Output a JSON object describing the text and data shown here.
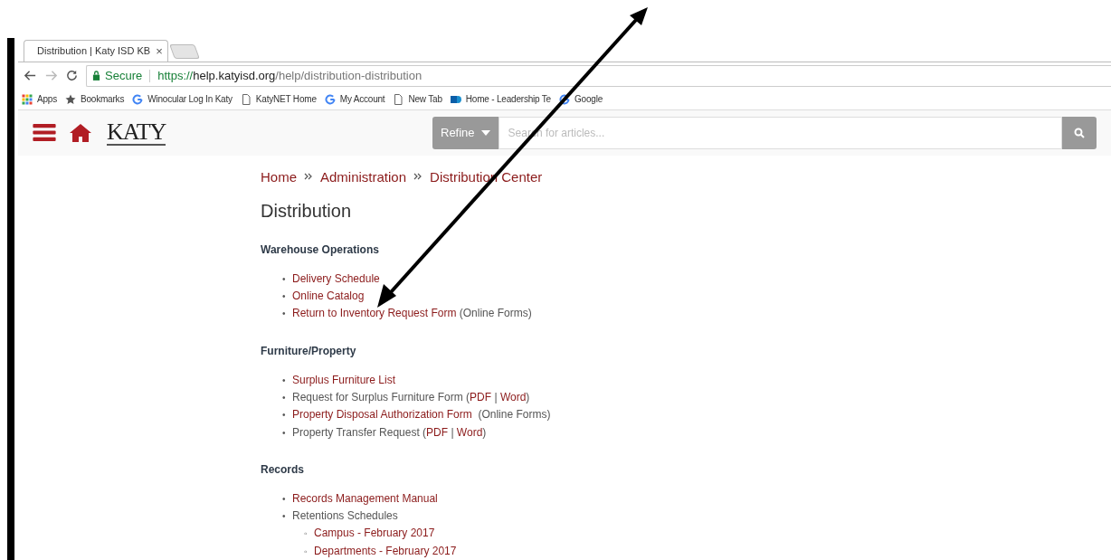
{
  "browser": {
    "tab": {
      "title": "Distribution | Katy ISD KB",
      "close": "×"
    },
    "address": {
      "secure_label": "Secure",
      "scheme": "https://",
      "host": "help.katyisd.org",
      "path": "/help/distribution-distribution"
    },
    "bookmarks": [
      {
        "kind": "apps",
        "label": "Apps"
      },
      {
        "kind": "star",
        "label": "Bookmarks"
      },
      {
        "kind": "google",
        "label": "Winocular Log In Katy"
      },
      {
        "kind": "page",
        "label": "KatyNET Home"
      },
      {
        "kind": "google",
        "label": "My Account"
      },
      {
        "kind": "page",
        "label": "New Tab"
      },
      {
        "kind": "sharepoint",
        "label": "Home - Leadership Te"
      },
      {
        "kind": "google",
        "label": "Google"
      }
    ]
  },
  "header": {
    "logo": "KATY",
    "refine": "Refine",
    "search": {
      "placeholder": "Search for articles..."
    }
  },
  "breadcrumbs": [
    "Home",
    "Administration",
    "Distribution Center"
  ],
  "title": "Distribution",
  "sections": [
    {
      "heading": "Warehouse Operations",
      "items": [
        {
          "marker": "•",
          "parts": [
            {
              "kind": "link",
              "text": "Delivery Schedule"
            }
          ]
        },
        {
          "marker": "•",
          "parts": [
            {
              "kind": "link",
              "text": "Online Catalog"
            }
          ]
        },
        {
          "marker": "•",
          "parts": [
            {
              "kind": "link",
              "text": "Return to Inventory Request Form"
            },
            {
              "kind": "text",
              "text": " (Online Forms)"
            }
          ]
        }
      ]
    },
    {
      "heading": "Furniture/Property",
      "items": [
        {
          "marker": "•",
          "parts": [
            {
              "kind": "link",
              "text": "Surplus Furniture List"
            }
          ]
        },
        {
          "marker": "•",
          "parts": [
            {
              "kind": "text",
              "text": "Request for Surplus Furniture Form ("
            },
            {
              "kind": "link",
              "text": "PDF"
            },
            {
              "kind": "text",
              "text": " | "
            },
            {
              "kind": "link",
              "text": "Word"
            },
            {
              "kind": "text",
              "text": ")"
            }
          ]
        },
        {
          "marker": "•",
          "parts": [
            {
              "kind": "link",
              "text": "Property Disposal Authorization Form"
            },
            {
              "kind": "text",
              "text": "  (Online Forms)"
            }
          ]
        },
        {
          "marker": "•",
          "parts": [
            {
              "kind": "text",
              "text": "Property Transfer Request ("
            },
            {
              "kind": "link",
              "text": "PDF"
            },
            {
              "kind": "text",
              "text": " | "
            },
            {
              "kind": "link",
              "text": "Word"
            },
            {
              "kind": "text",
              "text": ")"
            }
          ]
        }
      ]
    },
    {
      "heading": "Records",
      "items": [
        {
          "marker": "•",
          "parts": [
            {
              "kind": "link",
              "text": "Records Management Manual"
            }
          ]
        },
        {
          "marker": "•",
          "parts": [
            {
              "kind": "text",
              "text": "Retentions Schedules"
            }
          ],
          "children": [
            {
              "marker": "◦",
              "parts": [
                {
                  "kind": "link",
                  "text": "Campus - February 2017"
                }
              ]
            },
            {
              "marker": "◦",
              "parts": [
                {
                  "kind": "link",
                  "text": "Departments - February 2017"
                }
              ]
            }
          ]
        }
      ]
    }
  ]
}
